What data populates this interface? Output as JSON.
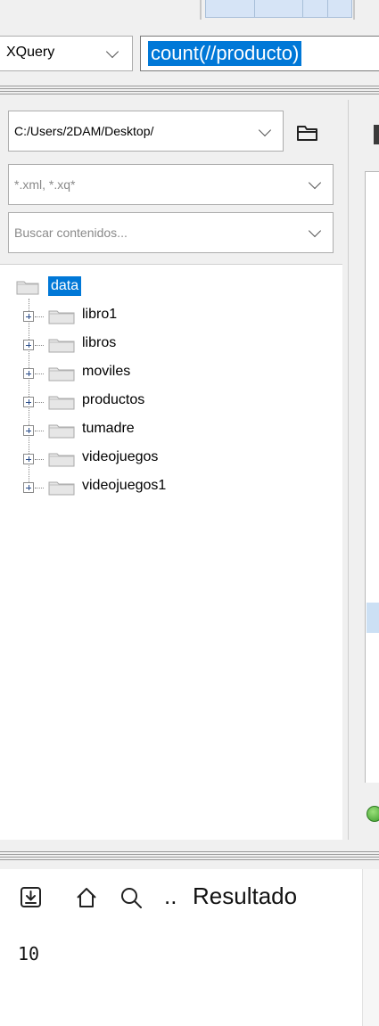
{
  "query": {
    "type_label": "XQuery",
    "text": "count(//producto)"
  },
  "file_browser": {
    "path": "C:/Users/2DAM/Desktop/",
    "filter_placeholder": "*.xml, *.xq*",
    "search_placeholder": "Buscar contenidos...",
    "tree": {
      "root": "data",
      "items": [
        "libro1",
        "libros",
        "moviles",
        "productos",
        "tumadre",
        "videojuegos",
        "videojuegos1"
      ]
    }
  },
  "result": {
    "title": "Resultado",
    "ellipsis": "..",
    "value": "10"
  },
  "icons": {
    "save": "save-result-icon",
    "home": "home-icon",
    "search": "search-icon",
    "folder": "open-folder-icon",
    "status": "ok-status-icon"
  },
  "colors": {
    "selection": "#0078d7",
    "panel": "#f0f0f0"
  }
}
